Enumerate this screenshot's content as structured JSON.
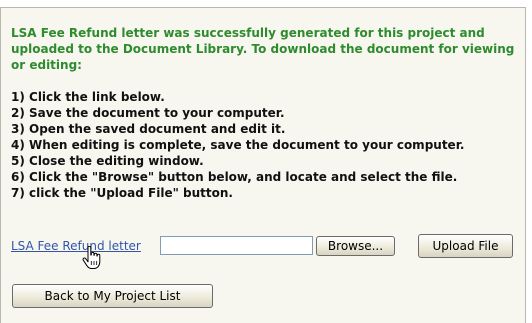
{
  "message": {
    "success": "LSA Fee Refund letter was successfully generated for this project and uploaded to the Document Library. To download the document for viewing or editing:"
  },
  "steps": [
    "1) Click the link below.",
    "2) Save the document to your computer.",
    "3) Open the saved document and edit it.",
    "4) When editing is complete, save the document to your computer.",
    "5) Close the editing window.",
    "6) Click the \"Browse\" button below, and locate and select the file.",
    "7) click the \"Upload File\" button."
  ],
  "document_link": {
    "label": "LSA Fee Refund letter"
  },
  "upload": {
    "file_value": "",
    "browse_label": "Browse...",
    "upload_label": "Upload File"
  },
  "navigation": {
    "back_label": "Back to My Project List"
  },
  "colors": {
    "panel_background": "#f7f7ef",
    "success_text": "#2e8b2e",
    "link": "#3355aa"
  },
  "icons": {
    "cursor": "hand-pointer-icon"
  }
}
